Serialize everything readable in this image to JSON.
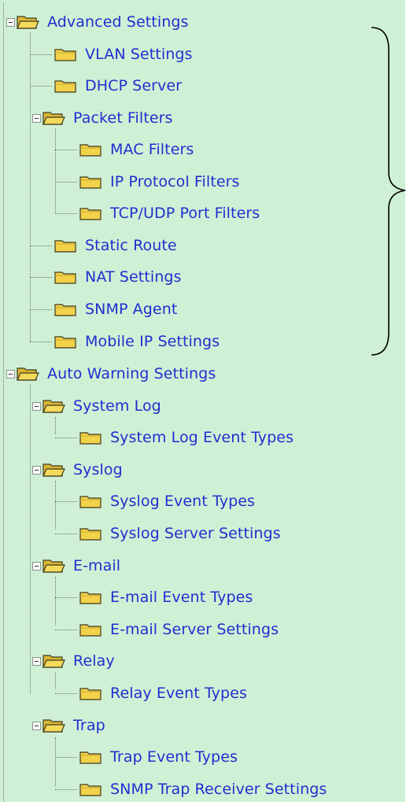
{
  "tree": {
    "advanced": {
      "label": "Advanced Settings",
      "vlan": "VLAN Settings",
      "dhcp": "DHCP Server",
      "packet_filters": {
        "label": "Packet Filters",
        "mac": "MAC Filters",
        "ip_protocol": "IP Protocol Filters",
        "tcp_udp": "TCP/UDP Port Filters"
      },
      "static_route": "Static Route",
      "nat": "NAT Settings",
      "snmp_agent": "SNMP Agent",
      "mobile_ip": "Mobile IP Settings"
    },
    "auto_warning": {
      "label": "Auto Warning Settings",
      "system_log": {
        "label": "System Log",
        "event_types": "System Log Event Types"
      },
      "syslog": {
        "label": "Syslog",
        "event_types": "Syslog Event Types",
        "server": "Syslog Server Settings"
      },
      "email": {
        "label": "E-mail",
        "event_types": "E-mail Event Types",
        "server": "E-mail Server Settings"
      },
      "relay": {
        "label": "Relay",
        "event_types": "Relay Event Types"
      },
      "trap": {
        "label": "Trap",
        "event_types": "Trap Event Types",
        "receiver": "SNMP Trap Receiver Settings"
      }
    }
  },
  "colors": {
    "panel_background": "#cff0d5",
    "link_text": "#1f2fcf",
    "folder_fill": "#f2d24a"
  }
}
